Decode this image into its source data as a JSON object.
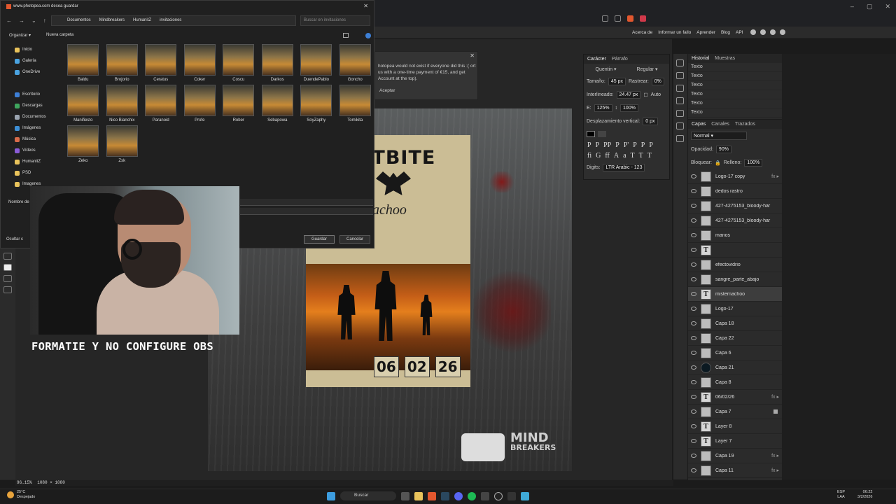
{
  "browser": {
    "dialog_site_title": "www.photopea.com desea guardar"
  },
  "photopea_links": [
    "Acerca de",
    "Informar un fallo",
    "Aprender",
    "Blog",
    "API"
  ],
  "dialog": {
    "breadcrumb": [
      "Documentos",
      "Mindbreakers",
      "HumanitZ",
      "invitaciones"
    ],
    "search_placeholder": "Buscar en invitaciones",
    "organize": "Organizar ▾",
    "new_folder": "Nueva carpeta",
    "sidebar": [
      {
        "label": "Inicio",
        "color": "#e9c35b"
      },
      {
        "label": "Galería",
        "color": "#4aa3e0"
      },
      {
        "label": "OneDrive",
        "color": "#4aa3e0"
      },
      {
        "label": "",
        "color": "#202020"
      },
      {
        "label": "Escritorio",
        "color": "#3d7fd6"
      },
      {
        "label": "Descargas",
        "color": "#3fa65e"
      },
      {
        "label": "Documentos",
        "color": "#9aa4b0"
      },
      {
        "label": "Imágenes",
        "color": "#3d8fd6"
      },
      {
        "label": "Música",
        "color": "#d86b4a"
      },
      {
        "label": "Vídeos",
        "color": "#8a5cd6"
      },
      {
        "label": "HumanitZ",
        "color": "#e9c35b"
      },
      {
        "label": "PSD",
        "color": "#e9c35b"
      },
      {
        "label": "Imagenes",
        "color": "#e9c35b"
      }
    ],
    "files": [
      "Baldu",
      "Brojorio",
      "Ceratus",
      "Coker",
      "Coscu",
      "Darkos",
      "DuendePablo",
      "Goncho",
      "Manifiesto",
      "Nico Bianchix",
      "Paranoid",
      "Profe",
      "Rober",
      "Sebapowa",
      "SoyZaphy",
      "Tomikita",
      "Zeko",
      "Zsk"
    ],
    "name_label": "Nombre de",
    "hide_folders": "Ocultar c",
    "save": "Guardar",
    "cancel": "Cancelar"
  },
  "notification": {
    "text": "hotopea would not exist if everyone did this :( ort us with a one-time payment of €15, and get Account at the top).",
    "accept": "Aceptar"
  },
  "character_panel": {
    "tabs": [
      "Carácter",
      "Párrafo"
    ],
    "font": "Quentin",
    "style": "Regular",
    "size_label": "Tamaño:",
    "size": "45 px",
    "tracking_label": "Rastrear:",
    "tracking": "0%",
    "leading_label": "Interlineado:",
    "leading": "24.47 px",
    "auto": "Auto",
    "hscale_label": "E:",
    "hscale": "125%",
    "vscale": "100%",
    "baseline_label": "Desplazamiento vertical:",
    "baseline": "0 px",
    "digits_label": "Digits:",
    "digits": "LTR Arabic - 123",
    "glyphs": [
      "P",
      "P",
      "PP",
      "P",
      "P'",
      "P",
      "P",
      "P",
      "fi",
      "G",
      "ff",
      "A",
      "a",
      "T",
      "T",
      "T"
    ]
  },
  "history": {
    "tabs": [
      "Historial",
      "Muestras"
    ],
    "items": [
      "Texto",
      "Texto",
      "Texto",
      "Texto",
      "Texto",
      "Texto"
    ]
  },
  "layers": {
    "tabs": [
      "Capas",
      "Canales",
      "Trazados"
    ],
    "blend": "Normal",
    "opacity_label": "Opacidad:",
    "opacity": "90%",
    "lock_label": "Bloquear:",
    "fill_label": "Relleno:",
    "fill": "100%",
    "items": [
      {
        "name": "Logo-17 copy",
        "kind": "img",
        "fx": true
      },
      {
        "name": "dedos rastro",
        "kind": "img"
      },
      {
        "name": "427-4275153_bloody-har",
        "kind": "img"
      },
      {
        "name": "427-4275153_bloody-har",
        "kind": "img"
      },
      {
        "name": "manos",
        "kind": "img"
      },
      {
        "name": "",
        "kind": "text"
      },
      {
        "name": "efectovidrio",
        "kind": "img"
      },
      {
        "name": "sangre_parte_abajo",
        "kind": "img"
      },
      {
        "name": "misternachoo",
        "kind": "text",
        "selected": true
      },
      {
        "name": "Logo-17",
        "kind": "img"
      },
      {
        "name": "Capa 18",
        "kind": "img"
      },
      {
        "name": "Capa 22",
        "kind": "img"
      },
      {
        "name": "Capa 6",
        "kind": "img"
      },
      {
        "name": "Capa 21",
        "kind": "dark"
      },
      {
        "name": "Capa 8",
        "kind": "img"
      },
      {
        "name": "06/02/26",
        "kind": "text",
        "fx": true
      },
      {
        "name": "Capa 7",
        "kind": "img",
        "lock": true
      },
      {
        "name": "Layer 8",
        "kind": "text"
      },
      {
        "name": "Layer 7",
        "kind": "text"
      },
      {
        "name": "Capa 19",
        "kind": "img",
        "fx": true
      },
      {
        "name": "Capa 11",
        "kind": "img",
        "fx": true
      }
    ]
  },
  "poster": {
    "title": "OSTBITE",
    "name": "erNachoo",
    "date": [
      "06",
      "02",
      "26"
    ],
    "logo_line1": "MIND",
    "logo_line2": "BREAKERS"
  },
  "status": {
    "zoom": "96.15%",
    "size": "1080 × 1080"
  },
  "overlay_caption": "FORMATIE Y NO CONFIGURE OBS",
  "taskbar": {
    "temp": "25°C",
    "weather": "Despejado",
    "search": "Buscar",
    "lang1": "ESP",
    "lang2": "LAA",
    "time": "06:22",
    "date": "3/2/2026"
  }
}
